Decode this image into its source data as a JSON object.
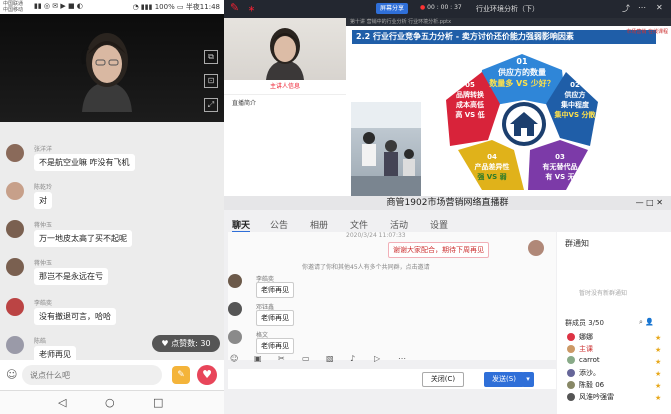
{
  "phone": {
    "status": {
      "carrier1": "中国联通",
      "carrier2": "中国移动",
      "battery": "100%",
      "time": "半夜11:48"
    },
    "messages": [
      {
        "name": "张洋洋",
        "text": "不是航空业嘛 咋没有飞机"
      },
      {
        "name": "陈乾玲",
        "text": "对"
      },
      {
        "name": "蒋仲玉",
        "text": "万一地皮太高了买不起呢"
      },
      {
        "name": "蒋仲玉",
        "text": "那岂不是永远在亏"
      },
      {
        "name": "李皓奕",
        "text": "没有撤退可言，哈哈"
      },
      {
        "name": "陈皓",
        "text": "老师再见"
      }
    ],
    "likes": "点赞数: 30",
    "input_placeholder": "说点什么吧"
  },
  "desktop": {
    "topbar": {
      "share": "屏幕分享",
      "timer": "00 : 00 : 37",
      "title": "行业环境分析（下）"
    },
    "doc_title": "第十讲 营销中的行业分析 行业环境分析.pptx",
    "sidebar_link": "主讲人信息",
    "sidebar_label": "直播简介",
    "slide": {
      "title": "2.2 行业行业竞争五力分析 - 卖方讨价还价能力强弱影响因素",
      "badge": "市场营销 在线课程",
      "items": [
        {
          "num": "01",
          "line1": "供应方的数量",
          "line2": "数量多 VS 少好？",
          "color": "#2f86d8"
        },
        {
          "num": "02",
          "line1": "供应方",
          "line2": "集中程度",
          "line3": "集中VS 分散",
          "color": "#1f5ea8"
        },
        {
          "num": "03",
          "line1": "有无替代品",
          "line2": "有 VS 无",
          "color": "#7c3aa8"
        },
        {
          "num": "04",
          "line1": "产品差异性",
          "line2": "强 VS 弱",
          "color": "#e0b21a"
        },
        {
          "num": "05",
          "line1": "品牌转换",
          "line2": "成本高低",
          "line3": "高 VS 低",
          "color": "#d8233a"
        }
      ]
    },
    "qq": {
      "title": "商管1902市场营销网络直播群",
      "tabs": [
        "聊天",
        "公告",
        "相册",
        "文件",
        "活动",
        "设置"
      ],
      "timestamp": "2020/3/24 11:07:33",
      "system_note": "谢谢大家配合，期待下周再见",
      "invite_note": "你邀请了你和其他45人有多个共同群，点击邀请",
      "chat": [
        {
          "name": "李皓奕",
          "text": "老师再见"
        },
        {
          "name": "邓钰鑫",
          "text": "老师再见"
        },
        {
          "name": "格文",
          "text": "老师再见"
        }
      ],
      "close_btn": "关闭(C)",
      "send_btn": "发送(S)",
      "announce_title": "群通知",
      "announce_body": "暂时没有新群通知",
      "members_title": "群成员 3/50",
      "members": [
        "娜娜",
        "主课",
        "carrot",
        "添沙。",
        "陈毅 06",
        "风淮吟强雷"
      ]
    }
  }
}
